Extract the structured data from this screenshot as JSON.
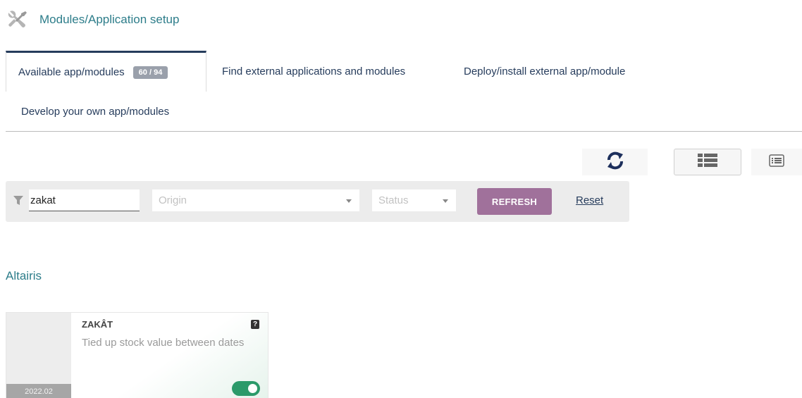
{
  "header": {
    "title": "Modules/Application setup",
    "icon": "tools-icon"
  },
  "tabs": [
    {
      "label": "Available app/modules",
      "badge": "60 / 94",
      "active": true
    },
    {
      "label": "Find external applications and modules",
      "active": false
    },
    {
      "label": "Deploy/install external app/module",
      "active": false
    },
    {
      "label": "Develop your own app/modules",
      "active": false
    }
  ],
  "view_switcher": {
    "icons": [
      "refresh-icon",
      "kanban-view-icon",
      "list-view-icon"
    ],
    "accent_color": "#263c5c"
  },
  "filters": {
    "search_value": "zakat",
    "origin_placeholder": "Origin",
    "status_placeholder": "Status",
    "refresh_label": "REFRESH",
    "reset_label": "Reset",
    "refresh_color": "#a0719b"
  },
  "groups": [
    {
      "title": "Altairis",
      "modules": [
        {
          "name": "ZAKÂT",
          "description": "Tied up stock value between dates",
          "version": "2022.02",
          "enabled": true,
          "toggle_color": "#2b9a6a"
        }
      ]
    }
  ]
}
